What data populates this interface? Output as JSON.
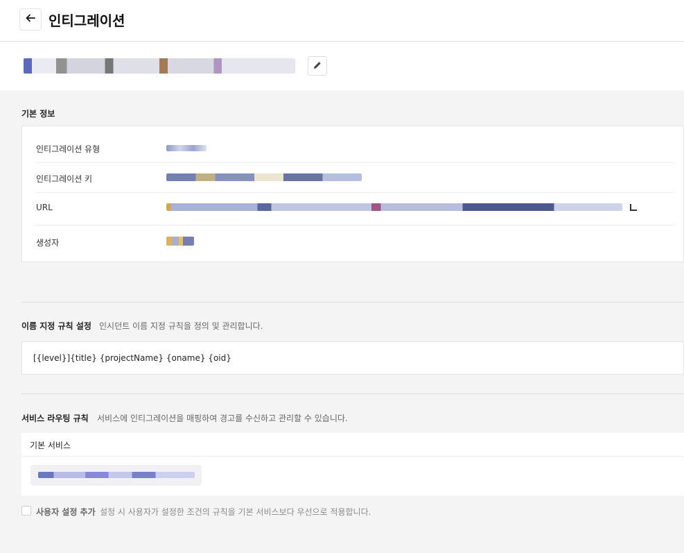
{
  "header": {
    "title": "인티그레이션",
    "back_icon": "arrow-left-icon"
  },
  "integration": {
    "name_redacted": true,
    "edit_icon": "pencil-icon"
  },
  "basic_info": {
    "title": "기본 정보",
    "rows": [
      {
        "label": "인티그레이션 유형"
      },
      {
        "label": "인티그레이션 키"
      },
      {
        "label": "URL"
      },
      {
        "label": "생성자"
      }
    ]
  },
  "naming_rule": {
    "title": "이름 지정 규칙 설정",
    "description": "인시던트 이름 지정 규칙을 정의 및 관리합니다.",
    "value": "[{level}]{title} {projectName} {oname} {oid}"
  },
  "routing": {
    "title": "서비스 라우팅 규칙",
    "description": "서비스에 인티그레이션을 매핑하여 경고를 수신하고 관리할 수 있습니다.",
    "default_service_label": "기본 서비스"
  },
  "custom_setting": {
    "label": "사용자 설정 추가",
    "description": "설정 시 사용자가 설정한 조건의 규칙을 기본 서비스보다 우선으로 적용합니다.",
    "checked": false
  },
  "colors": {
    "background": "#f4f4f5",
    "card": "#ffffff",
    "border": "#e4e4e4"
  }
}
